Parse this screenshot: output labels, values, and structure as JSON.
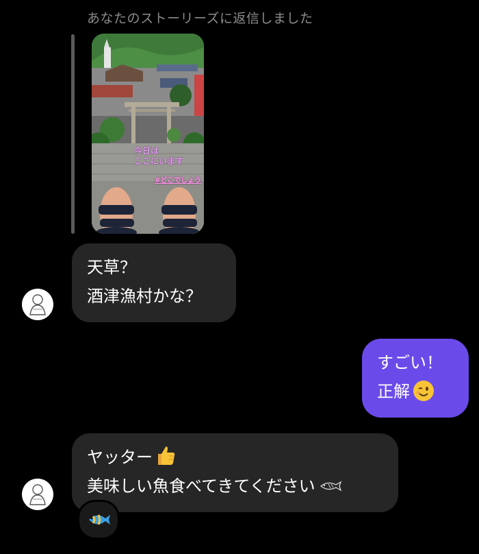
{
  "reply_label": "あなたのストーリーズに返信しました",
  "story": {
    "caption_line1": "今日は\nここにいます",
    "caption_line2": "#どこでしょう"
  },
  "messages": [
    {
      "side": "incoming",
      "lines": [
        "天草？",
        "酒津漁村かな？"
      ]
    },
    {
      "side": "outgoing",
      "lines": [
        "すごい！",
        "正解"
      ],
      "emoji": "winking-face-icon"
    },
    {
      "side": "incoming",
      "lines": [
        "ヤッター",
        "美味しい魚食べてきてください"
      ],
      "emoji": [
        "thumbs-up-icon",
        "fish-icon"
      ]
    }
  ],
  "reaction": {
    "emoji": "tropical-fish-icon"
  },
  "colors": {
    "background": "#000000",
    "incoming_bubble": "#262626",
    "outgoing_bubble": "#6a4bea",
    "muted_text": "#8c8c8c"
  }
}
